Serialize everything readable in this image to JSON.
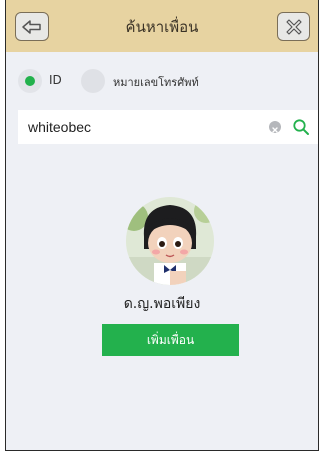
{
  "header": {
    "title": "ค้นหาเพื่อน",
    "back_icon": "back-arrow-icon",
    "close_icon": "close-x-icon"
  },
  "search_type": {
    "selected": "ID",
    "options": [
      {
        "label": "ID",
        "selected": true
      },
      {
        "label": "หมายเลขโทรศัพท์",
        "selected": false
      }
    ]
  },
  "search": {
    "value": "whiteobec"
  },
  "result": {
    "name": "ด.ญ.พอเพียง",
    "add_button_label": "เพิ่มเพื่อน"
  },
  "colors": {
    "header_bg": "#e7d3a1",
    "accent_green": "#23b14d",
    "page_bg": "#eef0f5"
  }
}
